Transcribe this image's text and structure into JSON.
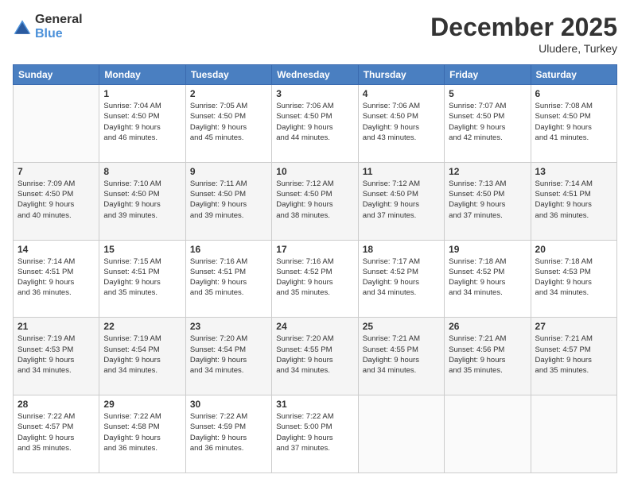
{
  "logo": {
    "general": "General",
    "blue": "Blue"
  },
  "header": {
    "month": "December 2025",
    "location": "Uludere, Turkey"
  },
  "weekdays": [
    "Sunday",
    "Monday",
    "Tuesday",
    "Wednesday",
    "Thursday",
    "Friday",
    "Saturday"
  ],
  "weeks": [
    [
      {
        "day": "",
        "info": ""
      },
      {
        "day": "1",
        "info": "Sunrise: 7:04 AM\nSunset: 4:50 PM\nDaylight: 9 hours\nand 46 minutes."
      },
      {
        "day": "2",
        "info": "Sunrise: 7:05 AM\nSunset: 4:50 PM\nDaylight: 9 hours\nand 45 minutes."
      },
      {
        "day": "3",
        "info": "Sunrise: 7:06 AM\nSunset: 4:50 PM\nDaylight: 9 hours\nand 44 minutes."
      },
      {
        "day": "4",
        "info": "Sunrise: 7:06 AM\nSunset: 4:50 PM\nDaylight: 9 hours\nand 43 minutes."
      },
      {
        "day": "5",
        "info": "Sunrise: 7:07 AM\nSunset: 4:50 PM\nDaylight: 9 hours\nand 42 minutes."
      },
      {
        "day": "6",
        "info": "Sunrise: 7:08 AM\nSunset: 4:50 PM\nDaylight: 9 hours\nand 41 minutes."
      }
    ],
    [
      {
        "day": "7",
        "info": "Sunrise: 7:09 AM\nSunset: 4:50 PM\nDaylight: 9 hours\nand 40 minutes."
      },
      {
        "day": "8",
        "info": "Sunrise: 7:10 AM\nSunset: 4:50 PM\nDaylight: 9 hours\nand 39 minutes."
      },
      {
        "day": "9",
        "info": "Sunrise: 7:11 AM\nSunset: 4:50 PM\nDaylight: 9 hours\nand 39 minutes."
      },
      {
        "day": "10",
        "info": "Sunrise: 7:12 AM\nSunset: 4:50 PM\nDaylight: 9 hours\nand 38 minutes."
      },
      {
        "day": "11",
        "info": "Sunrise: 7:12 AM\nSunset: 4:50 PM\nDaylight: 9 hours\nand 37 minutes."
      },
      {
        "day": "12",
        "info": "Sunrise: 7:13 AM\nSunset: 4:50 PM\nDaylight: 9 hours\nand 37 minutes."
      },
      {
        "day": "13",
        "info": "Sunrise: 7:14 AM\nSunset: 4:51 PM\nDaylight: 9 hours\nand 36 minutes."
      }
    ],
    [
      {
        "day": "14",
        "info": "Sunrise: 7:14 AM\nSunset: 4:51 PM\nDaylight: 9 hours\nand 36 minutes."
      },
      {
        "day": "15",
        "info": "Sunrise: 7:15 AM\nSunset: 4:51 PM\nDaylight: 9 hours\nand 35 minutes."
      },
      {
        "day": "16",
        "info": "Sunrise: 7:16 AM\nSunset: 4:51 PM\nDaylight: 9 hours\nand 35 minutes."
      },
      {
        "day": "17",
        "info": "Sunrise: 7:16 AM\nSunset: 4:52 PM\nDaylight: 9 hours\nand 35 minutes."
      },
      {
        "day": "18",
        "info": "Sunrise: 7:17 AM\nSunset: 4:52 PM\nDaylight: 9 hours\nand 34 minutes."
      },
      {
        "day": "19",
        "info": "Sunrise: 7:18 AM\nSunset: 4:52 PM\nDaylight: 9 hours\nand 34 minutes."
      },
      {
        "day": "20",
        "info": "Sunrise: 7:18 AM\nSunset: 4:53 PM\nDaylight: 9 hours\nand 34 minutes."
      }
    ],
    [
      {
        "day": "21",
        "info": "Sunrise: 7:19 AM\nSunset: 4:53 PM\nDaylight: 9 hours\nand 34 minutes."
      },
      {
        "day": "22",
        "info": "Sunrise: 7:19 AM\nSunset: 4:54 PM\nDaylight: 9 hours\nand 34 minutes."
      },
      {
        "day": "23",
        "info": "Sunrise: 7:20 AM\nSunset: 4:54 PM\nDaylight: 9 hours\nand 34 minutes."
      },
      {
        "day": "24",
        "info": "Sunrise: 7:20 AM\nSunset: 4:55 PM\nDaylight: 9 hours\nand 34 minutes."
      },
      {
        "day": "25",
        "info": "Sunrise: 7:21 AM\nSunset: 4:55 PM\nDaylight: 9 hours\nand 34 minutes."
      },
      {
        "day": "26",
        "info": "Sunrise: 7:21 AM\nSunset: 4:56 PM\nDaylight: 9 hours\nand 35 minutes."
      },
      {
        "day": "27",
        "info": "Sunrise: 7:21 AM\nSunset: 4:57 PM\nDaylight: 9 hours\nand 35 minutes."
      }
    ],
    [
      {
        "day": "28",
        "info": "Sunrise: 7:22 AM\nSunset: 4:57 PM\nDaylight: 9 hours\nand 35 minutes."
      },
      {
        "day": "29",
        "info": "Sunrise: 7:22 AM\nSunset: 4:58 PM\nDaylight: 9 hours\nand 36 minutes."
      },
      {
        "day": "30",
        "info": "Sunrise: 7:22 AM\nSunset: 4:59 PM\nDaylight: 9 hours\nand 36 minutes."
      },
      {
        "day": "31",
        "info": "Sunrise: 7:22 AM\nSunset: 5:00 PM\nDaylight: 9 hours\nand 37 minutes."
      },
      {
        "day": "",
        "info": ""
      },
      {
        "day": "",
        "info": ""
      },
      {
        "day": "",
        "info": ""
      }
    ]
  ]
}
